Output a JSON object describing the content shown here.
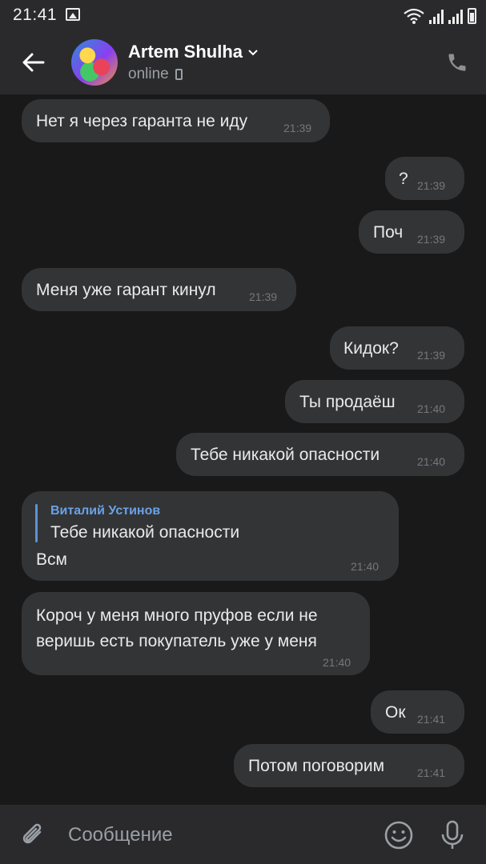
{
  "status_bar": {
    "time": "21:41"
  },
  "header": {
    "name": "Artem Shulha",
    "status": "online"
  },
  "messages": [
    {
      "text": "Нет я через гаранта не иду",
      "time": "21:39",
      "side": "in"
    },
    {
      "text": "?",
      "time": "21:39",
      "side": "out"
    },
    {
      "text": "Поч",
      "time": "21:39",
      "side": "out"
    },
    {
      "text": "Меня уже гарант кинул",
      "time": "21:39",
      "side": "in"
    },
    {
      "text": "Кидок?",
      "time": "21:39",
      "side": "out"
    },
    {
      "text": "Ты продаёш",
      "time": "21:40",
      "side": "out"
    },
    {
      "text": "Тебе никакой опасности",
      "time": "21:40",
      "side": "out"
    },
    {
      "reply_author": "Виталий Устинов",
      "reply_text": "Тебе никакой опасности",
      "text": "Всм",
      "time": "21:40",
      "side": "in"
    },
    {
      "line1": "Короч у меня много пруфов если не",
      "line2": "веришь есть покупатель уже у меня",
      "time": "21:40",
      "side": "in"
    },
    {
      "text": "Ок",
      "time": "21:41",
      "side": "out"
    },
    {
      "text": "Потом поговорим",
      "time": "21:41",
      "side": "out"
    }
  ],
  "composer": {
    "placeholder": "Сообщение"
  },
  "icons": [
    "back-arrow-icon",
    "chevron-down-icon",
    "phone-icon",
    "call-icon",
    "paperclip-icon",
    "smiley-icon",
    "microphone-icon"
  ],
  "colors": {
    "background": "#19191a",
    "bar": "#2a2a2c",
    "bubble": "#333436",
    "reply_accent": "#5a94d8"
  }
}
